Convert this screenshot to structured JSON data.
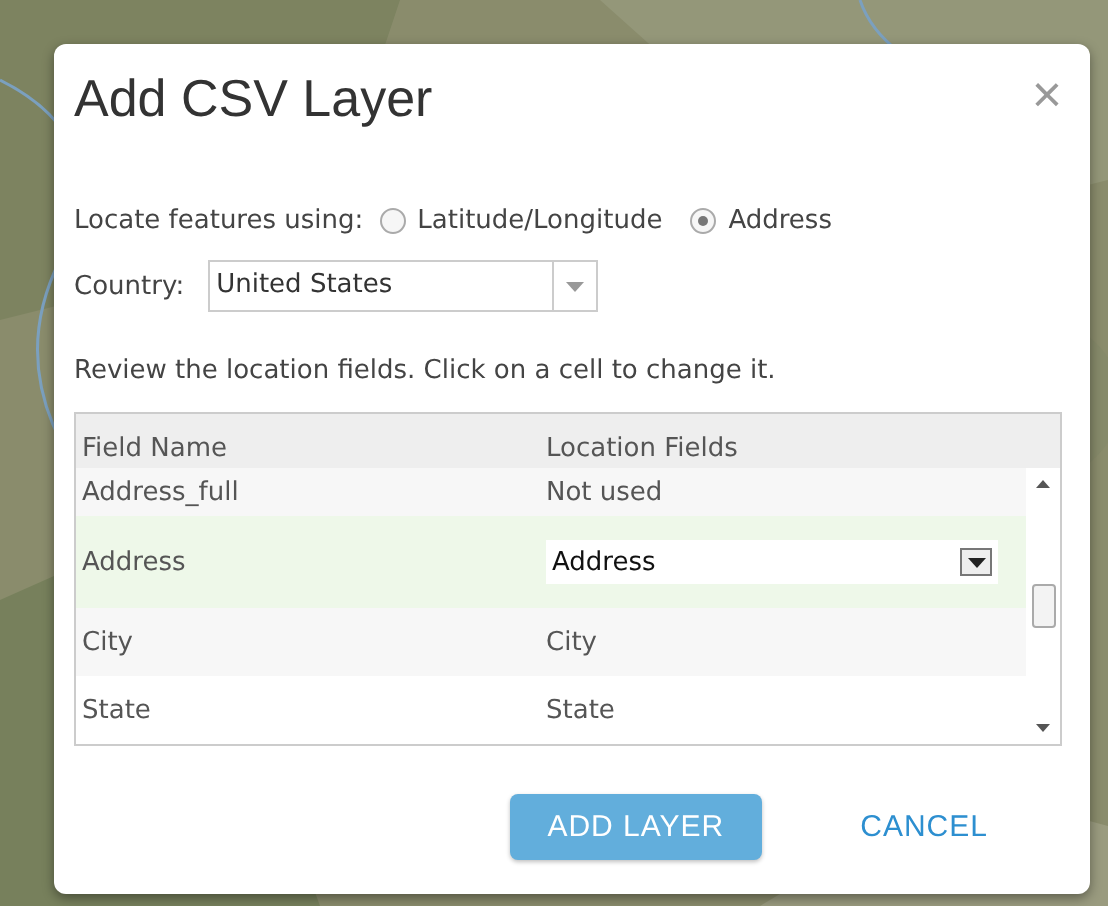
{
  "dialog": {
    "title": "Add CSV Layer",
    "close": "×"
  },
  "locate": {
    "label": "Locate features using:",
    "options": [
      {
        "label": "Latitude/Longitude",
        "selected": false
      },
      {
        "label": "Address",
        "selected": true
      }
    ]
  },
  "country": {
    "label": "Country:",
    "value": "United States"
  },
  "instructions": "Review the location fields. Click on a cell to change it.",
  "table": {
    "columns": [
      "Field Name",
      "Location Fields"
    ],
    "rows": [
      {
        "field": "Address_full",
        "location": "Not used",
        "selected": false,
        "kind": "text"
      },
      {
        "field": "Address",
        "location": "Address",
        "selected": true,
        "kind": "dropdown"
      },
      {
        "field": "City",
        "location": "City",
        "selected": false,
        "kind": "text"
      },
      {
        "field": "State",
        "location": "State",
        "selected": false,
        "kind": "text"
      }
    ]
  },
  "buttons": [
    {
      "label": "ADD LAYER",
      "kind": "primary"
    },
    {
      "label": "CANCEL",
      "kind": "link"
    }
  ]
}
